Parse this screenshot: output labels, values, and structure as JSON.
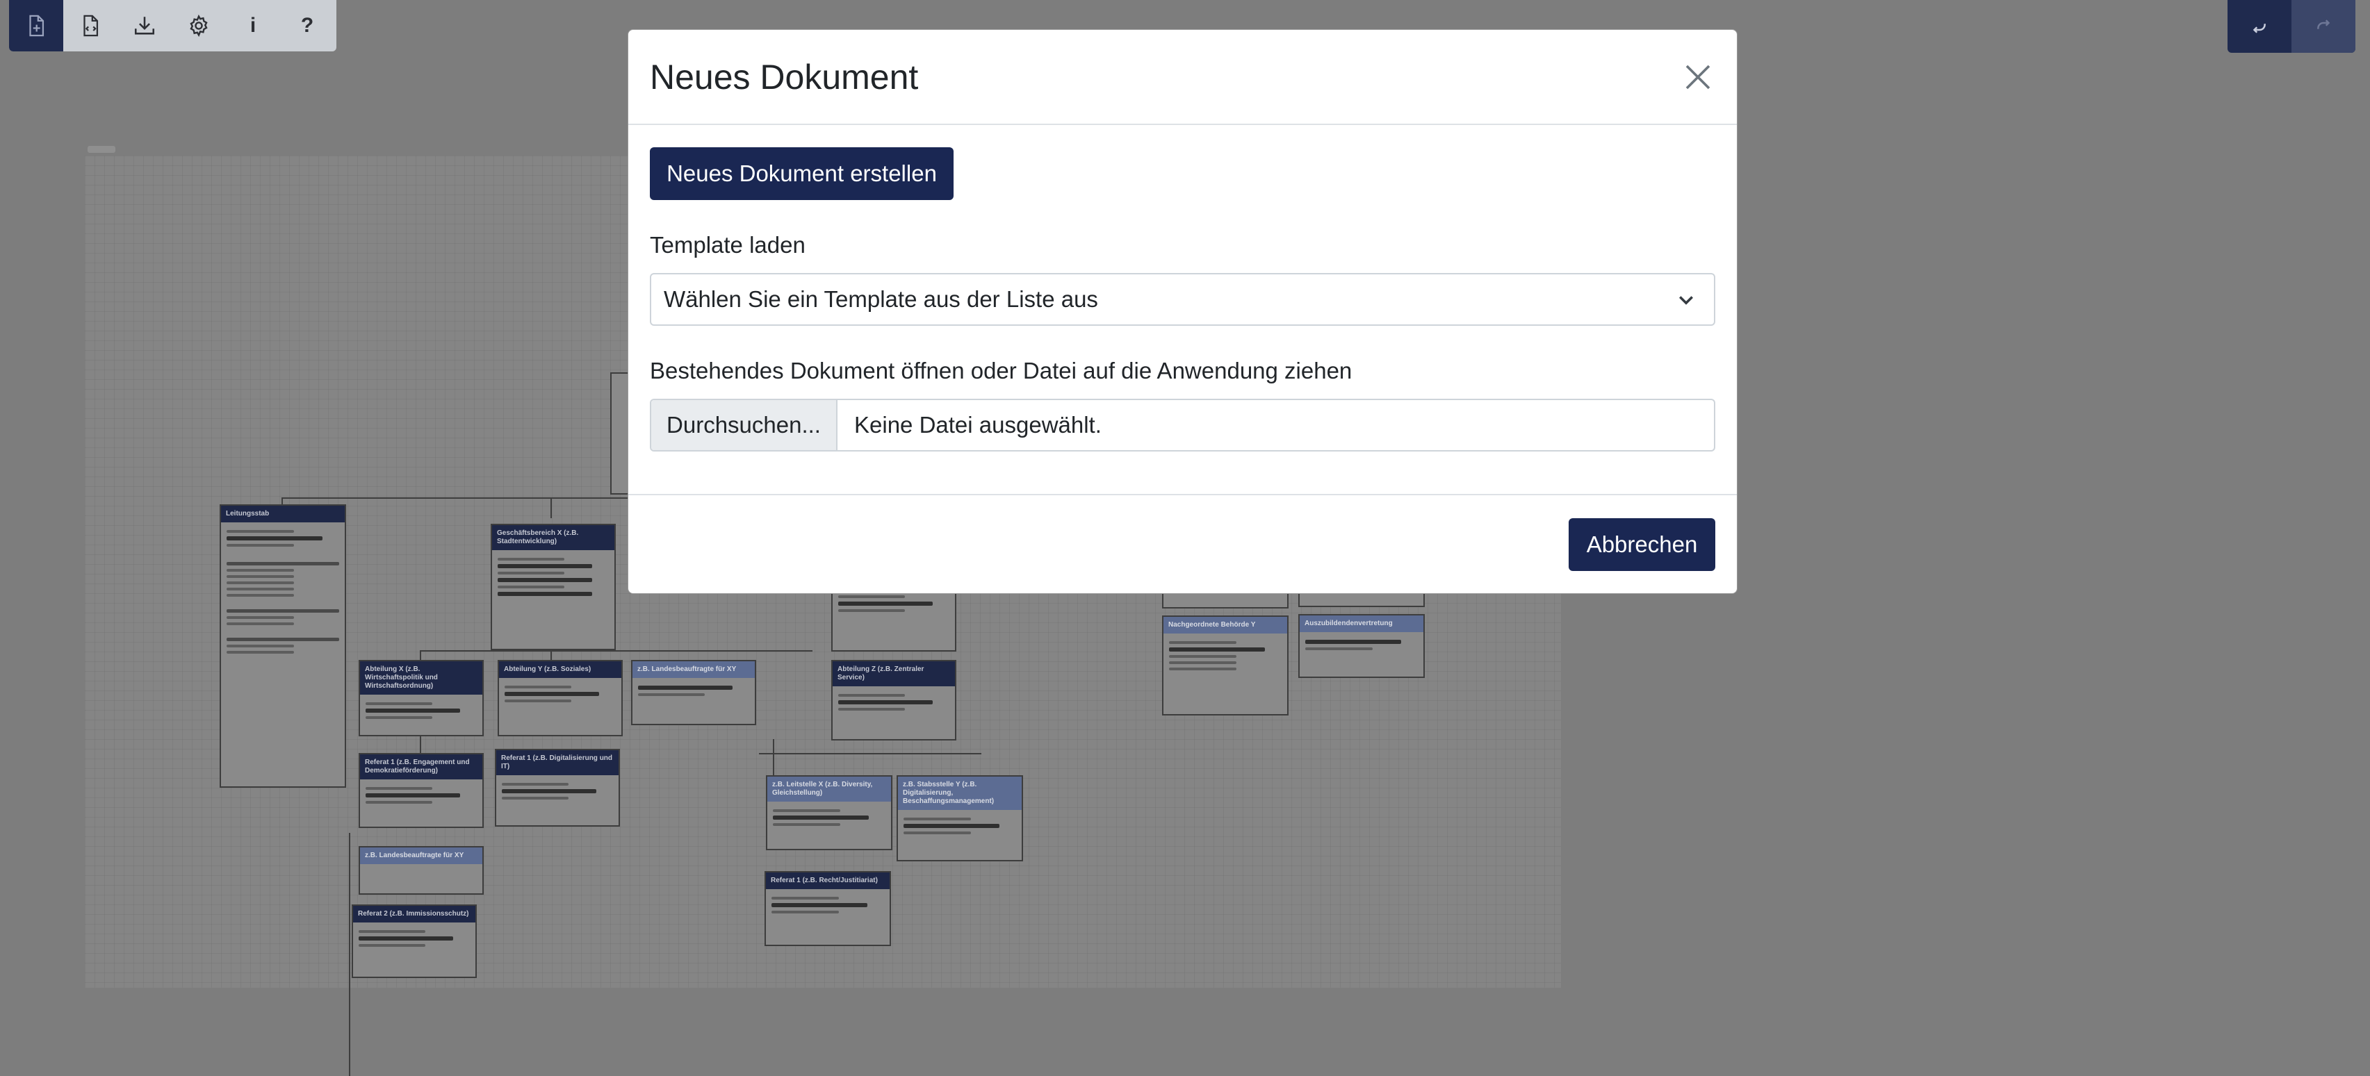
{
  "toolbar": {
    "items": [
      {
        "icon": "new-document-icon"
      },
      {
        "icon": "open-document-icon"
      },
      {
        "icon": "download-icon"
      },
      {
        "icon": "gear-icon"
      },
      {
        "icon": "info-icon",
        "glyph": "i"
      },
      {
        "icon": "help-icon",
        "glyph": "?"
      }
    ]
  },
  "history": {
    "undo_icon": "undo-icon",
    "redo_icon": "redo-icon"
  },
  "canvas": {
    "node_titles": [
      "Leitungsstab",
      "Geschäftsbereich X (z.B. Stadtentwicklung)",
      "Abteilung X (z.B. Wirtschaftspolitik und Wirtschaftsordnung)",
      "Abteilung Y (z.B. Soziales)",
      "z.B. Landesbeauftragte für XY",
      "Abteilung Z (z.B. Zentraler Service)",
      "Referat 1 (z.B. Engagement und Demokratieförderung)",
      "Referat 1 (z.B. Digitalisierung und IT)",
      "z.B. Landesbeauftragte für XY",
      "Referat 2 (z.B. Immissionsschutz)",
      "z.B. Leitstelle X (z.B. Diversity, Gleichstellung)",
      "z.B. Stabsstelle Y (z.B. Digitalisierung, Beschaffungsmanagement)",
      "Referat 1 (z.B. Recht/Justitiariat)",
      "Nachgeordnete Behörde Y",
      "Auszubildendenvertretung"
    ]
  },
  "modal": {
    "title": "Neues Dokument",
    "create_button": "Neues Dokument erstellen",
    "template_label": "Template laden",
    "template_select_value": "Wählen Sie ein Template aus der Liste aus",
    "open_label": "Bestehendes Dokument öffnen oder Datei auf die Anwendung ziehen",
    "browse_button": "Durchsuchen...",
    "file_status": "Keine Datei ausgewählt.",
    "cancel_button": "Abbrechen"
  }
}
